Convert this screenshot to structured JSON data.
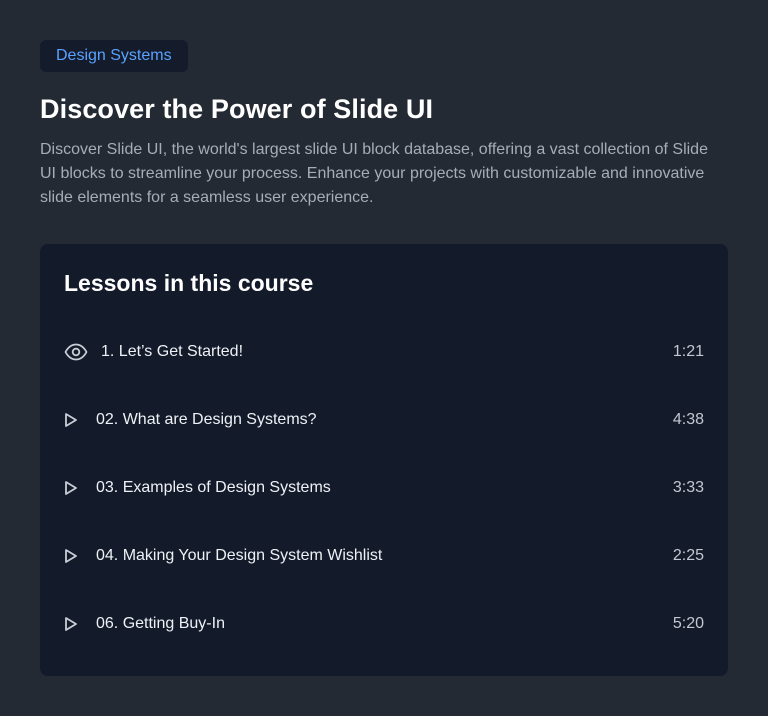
{
  "badge": {
    "label": "Design Systems"
  },
  "header": {
    "title": "Discover the Power of Slide UI",
    "description": "Discover Slide UI, the world's largest slide UI block database, offering a vast collection of Slide UI blocks to streamline your process. Enhance your projects with customizable and innovative slide elements for a seamless user experience."
  },
  "lessons_card": {
    "title": "Lessons in this course",
    "items": [
      {
        "icon": "eye-icon",
        "title": "1. Let’s Get Started!",
        "duration": "1:21"
      },
      {
        "icon": "play-icon",
        "title": "02. What are Design Systems?",
        "duration": "4:38"
      },
      {
        "icon": "play-icon",
        "title": "03. Examples of Design Systems",
        "duration": "3:33"
      },
      {
        "icon": "play-icon",
        "title": "04. Making Your Design System Wishlist",
        "duration": "2:25"
      },
      {
        "icon": "play-icon",
        "title": "06. Getting Buy-In",
        "duration": "5:20"
      }
    ]
  },
  "colors": {
    "page_bg": "#232a33",
    "card_bg": "#131a2a",
    "badge_bg": "#141b2b",
    "badge_text": "#5aa2ff"
  }
}
